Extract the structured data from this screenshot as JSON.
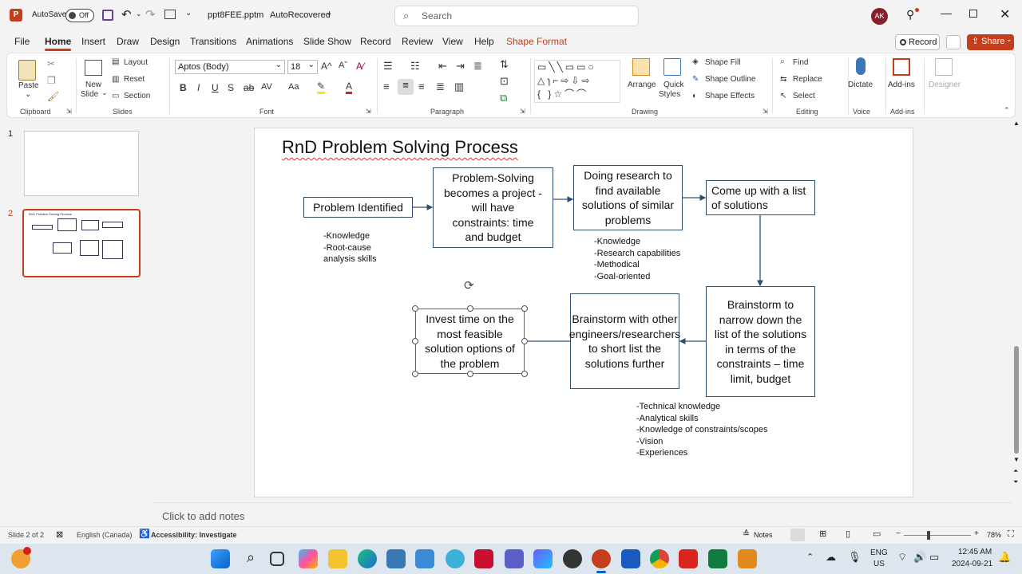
{
  "titlebar": {
    "autosave": "AutoSave",
    "toggle": "Off",
    "filename": "ppt8FEE.pptm",
    "status": "AutoRecovered",
    "search_placeholder": "Search",
    "avatar": "AK"
  },
  "menu": {
    "tabs": [
      "File",
      "Home",
      "Insert",
      "Draw",
      "Design",
      "Transitions",
      "Animations",
      "Slide Show",
      "Record",
      "Review",
      "View",
      "Help",
      "Shape Format"
    ],
    "record": "Record",
    "share": "Share"
  },
  "ribbon": {
    "clipboard": {
      "paste": "Paste",
      "label": "Clipboard"
    },
    "slides": {
      "new_slide_1": "New",
      "new_slide_2": "Slide",
      "layout": "Layout",
      "reset": "Reset",
      "section": "Section",
      "label": "Slides"
    },
    "font": {
      "name": "Aptos (Body)",
      "size": "18",
      "label": "Font"
    },
    "paragraph": {
      "label": "Paragraph"
    },
    "drawing": {
      "arrange": "Arrange",
      "quick1": "Quick",
      "quick2": "Styles",
      "fill": "Shape Fill",
      "outline": "Shape Outline",
      "effects": "Shape Effects",
      "label": "Drawing"
    },
    "editing": {
      "find": "Find",
      "replace": "Replace",
      "select": "Select",
      "label": "Editing"
    },
    "voice": {
      "dictate": "Dictate",
      "label": "Voice"
    },
    "addins": {
      "addins": "Add-ins",
      "label": "Add-ins"
    },
    "designer": {
      "label": "Designer"
    }
  },
  "thumbs": [
    "1",
    "2"
  ],
  "thumb2_title": "RnD Problem Solving Process",
  "slide": {
    "title": "RnD Problem Solving Process",
    "boxes": {
      "b1": "Problem Identified",
      "b2": "Problem-Solving becomes a project -will have constraints: time and budget",
      "b3": "Doing research to find available solutions of similar problems",
      "b4": "Come up with a list of solutions",
      "b5": "Brainstorm to narrow down the list of the solutions in terms of the constraints – time limit, budget",
      "b6": "Brainstorm with other engineers/researchers to short list the solutions further",
      "b7": "Invest time on the most feasible solution options of the problem"
    },
    "notes": {
      "n1": "-Knowledge\n-Root-cause\nanalysis skills",
      "n2": "-Knowledge\n-Research capabilities\n-Methodical\n-Goal-oriented",
      "n3": "-Technical knowledge\n-Analytical skills\n-Knowledge of constraints/scopes\n-Vision\n-Experiences"
    }
  },
  "notes_placeholder": "Click to add notes",
  "status": {
    "slide": "Slide 2 of 2",
    "lang": "English (Canada)",
    "access": "Accessibility: Investigate",
    "notes": "Notes",
    "zoom": "78%"
  },
  "taskbar": {
    "lang1": "ENG",
    "lang2": "US",
    "time": "12:45 AM",
    "date": "2024-09-21"
  },
  "colors": {
    "accent": "#c43e1c",
    "boxborder": "#2f4f6f"
  }
}
